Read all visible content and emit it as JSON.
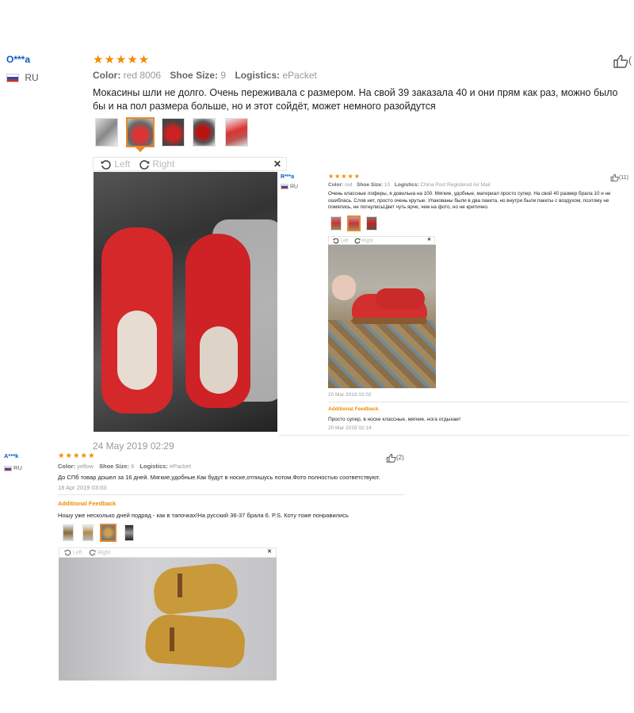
{
  "review1": {
    "user": "O***a",
    "country": "RU",
    "stars": "★★★★★",
    "color_label": "Color:",
    "color_value": "red 8006",
    "size_label": "Shoe Size:",
    "size_value": "9",
    "logistics_label": "Logistics:",
    "logistics_value": "ePacket",
    "likes": "(",
    "text": "Мокасины шли не долго. Очень переживала с размером. На свой 39 заказала 40 и они прям как раз, можно было бы и на пол размера больше, но и этот сойдёт, может немного разойдутся",
    "viewer": {
      "left": "Left",
      "right": "Right",
      "close": "✕"
    },
    "date": "24 May 2019 02:29"
  },
  "review2": {
    "user": "R***a",
    "country": "RU",
    "stars": "★★★★★",
    "color_label": "Color:",
    "color_value": "red",
    "size_label": "Shoe Size:",
    "size_value": "10",
    "logistics_label": "Logistics:",
    "logistics_value": "China Post Registered Air Mail",
    "likes": "(11)",
    "text": "Очень классные лоферы, я довольна на 100. Мягкие, удобные, материал просто супер. На свой 40 размер брала 10 и не ошиблась. Слов нет, просто очень крутые. Упакованы были в два пакета, но внутри были пакеты с воздухом, поэтому не помялись, не погнулисьЦвет чуть ярче, чем на фото, но не критично.",
    "viewer": {
      "left": "Left",
      "right": "Right",
      "close": "✕"
    },
    "date": "20 Mar 2019 02:02",
    "additional_label": "Additional Feedback",
    "additional_text": "Просто супер, в носке классные, мягкие, нога отдыхает",
    "additional_date": "20 Mar 2019 02:14"
  },
  "review3": {
    "user": "A***k",
    "country": "RU",
    "stars": "★★★★★",
    "color_label": "Color:",
    "color_value": "yellow",
    "size_label": "Shoe Size:",
    "size_value": "6",
    "logistics_label": "Logistics:",
    "logistics_value": "ePacket",
    "likes": "(2)",
    "text": "До СПб товар дошел за 16 дней. Мягкие,удобные.Как будут в носке,отпишусь потом.Фото полностью соответствуют.",
    "date": "18 Apr 2019 03:03",
    "additional_label": "Additional Feedback",
    "additional_text": "Ношу уже несколько дней подряд - как в тапочках!На русский 36-37 брала 6. P.S. Коту тоже понравились",
    "viewer": {
      "left": "Left",
      "right": "Right",
      "close": "✕"
    }
  },
  "colors": {
    "star": "#f08c00",
    "link": "#0a5bc4",
    "selected_border": "#e8892a"
  },
  "icons": [
    "thumbs-up-icon",
    "rotate-left-icon",
    "rotate-right-icon",
    "close-icon",
    "russia-flag-icon"
  ]
}
